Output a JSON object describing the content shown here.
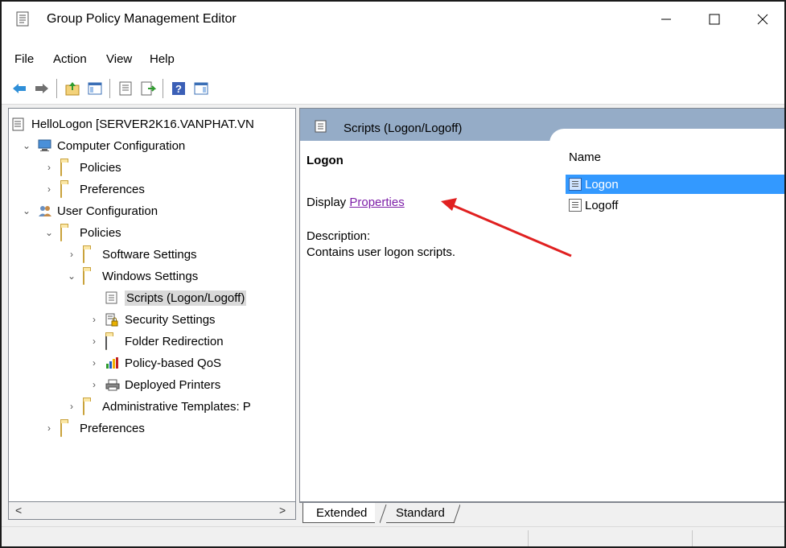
{
  "window": {
    "title": "Group Policy Management Editor",
    "controls": {
      "minimize": "—",
      "maximize": "☐",
      "close": "✕"
    }
  },
  "menubar": {
    "items": [
      "File",
      "Action",
      "View",
      "Help"
    ]
  },
  "toolbar": {
    "icons": [
      "back-icon",
      "forward-icon",
      "up-folder-icon",
      "show-hide-tree-icon",
      "properties-icon",
      "export-list-icon",
      "help-icon",
      "show-action-pane-icon"
    ]
  },
  "tree": {
    "root": "HelloLogon [SERVER2K16.VANPHAT.VN",
    "items": [
      {
        "label": "Computer Configuration",
        "expanded": true
      },
      {
        "label": "Policies"
      },
      {
        "label": "Preferences"
      },
      {
        "label": "User Configuration",
        "expanded": true
      },
      {
        "label": "Policies",
        "expanded": true
      },
      {
        "label": "Software Settings"
      },
      {
        "label": "Windows Settings",
        "expanded": true
      },
      {
        "label": "Scripts (Logon/Logoff)",
        "selected": true
      },
      {
        "label": "Security Settings"
      },
      {
        "label": "Folder Redirection"
      },
      {
        "label": "Policy-based QoS"
      },
      {
        "label": "Deployed Printers"
      },
      {
        "label": "Administrative Templates: P"
      },
      {
        "label": "Preferences"
      }
    ],
    "scroll_left": "<",
    "scroll_right": ">"
  },
  "details": {
    "header_title": "Scripts (Logon/Logoff)",
    "heading": "Logon",
    "display_prefix": "Display ",
    "properties_link": "Properties ",
    "description_label": "Description:",
    "description_text": "Contains user logon scripts.",
    "column_name": "Name",
    "list": [
      {
        "label": "Logon",
        "selected": true
      },
      {
        "label": "Logoff",
        "selected": false
      }
    ]
  },
  "bottom_tabs": {
    "extended": "Extended",
    "standard": "Standard"
  },
  "colors": {
    "header": "#95acc7",
    "selection": "#3399ff",
    "link": "#7d1fa8",
    "annotation": "#e02020"
  }
}
